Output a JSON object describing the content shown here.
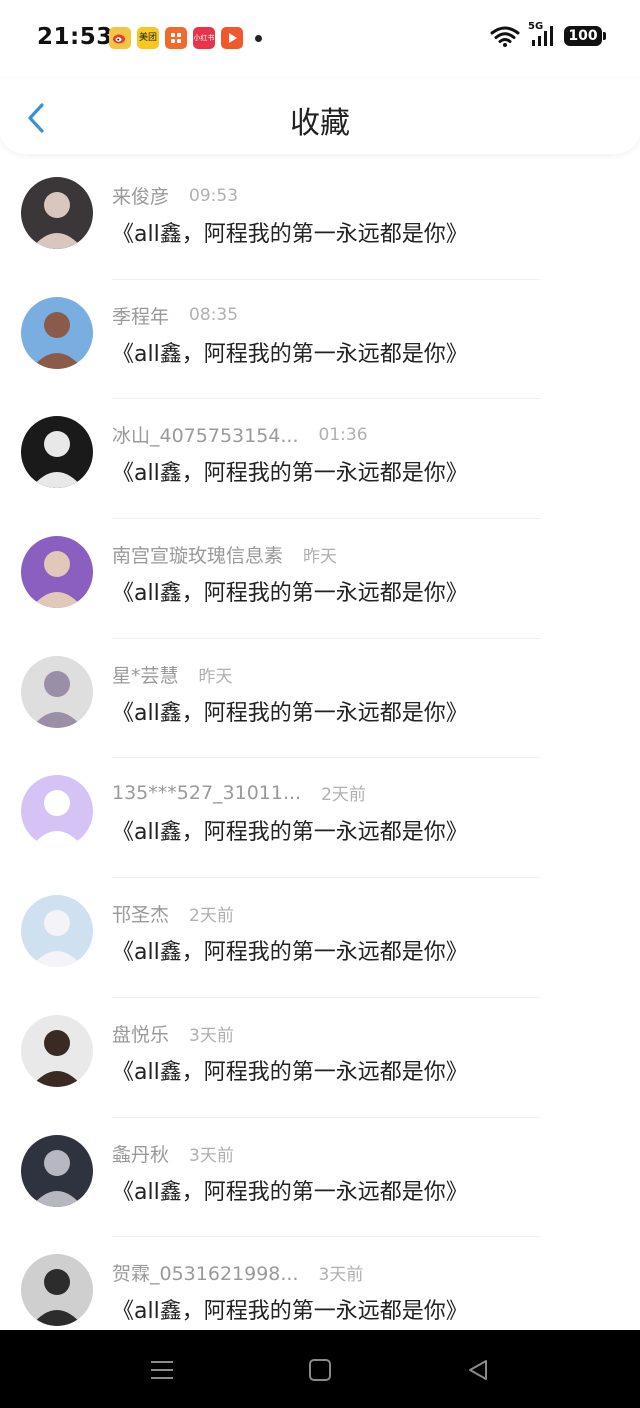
{
  "status_bar": {
    "time": "21:53",
    "network": "5G",
    "battery": "100",
    "apps": [
      {
        "icon": "weibo-icon",
        "label": "",
        "color": "#f4c542"
      },
      {
        "icon": "meituan-icon",
        "label": "美团",
        "color": "#f7c81f"
      },
      {
        "icon": "app-icon-orange",
        "label": "",
        "color": "#f06a2e"
      },
      {
        "icon": "xiaohongshu-icon",
        "label": "小红书",
        "color": "#e8344a"
      },
      {
        "icon": "video-app-icon",
        "label": "",
        "color": "#f0592e"
      }
    ]
  },
  "header": {
    "title": "收藏",
    "back_icon": "chevron-left-icon",
    "accent": "#3a8fd9"
  },
  "list": {
    "items": [
      {
        "user": "来俊彦",
        "time": "09:53",
        "title": "《all鑫，阿程我的第一永远都是你》",
        "avatar": {
          "bg": "#3b3637",
          "fg": "#d9c6bf"
        }
      },
      {
        "user": "季程年",
        "time": "08:35",
        "title": "《all鑫，阿程我的第一永远都是你》",
        "avatar": {
          "bg": "#7aaee0",
          "fg": "#8a5a4a"
        }
      },
      {
        "user": "冰山_4075753154...",
        "time": "01:36",
        "title": "《all鑫，阿程我的第一永远都是你》",
        "avatar": {
          "bg": "#1a1a1a",
          "fg": "#e8e8e8"
        }
      },
      {
        "user": "南宫宣璇玫瑰信息素",
        "time": "昨天",
        "title": "《all鑫，阿程我的第一永远都是你》",
        "avatar": {
          "bg": "#8a5fc0",
          "fg": "#e2c8b8"
        }
      },
      {
        "user": "星*芸慧",
        "time": "昨天",
        "title": "《all鑫，阿程我的第一永远都是你》",
        "avatar": {
          "bg": "#dedede",
          "fg": "#9b8fa8"
        }
      },
      {
        "user": "135***527_31011...",
        "time": "2天前",
        "title": "《all鑫，阿程我的第一永远都是你》",
        "avatar": {
          "bg": "#d6c3f5",
          "fg": "#ffffff"
        }
      },
      {
        "user": "邗圣杰",
        "time": "2天前",
        "title": "《all鑫，阿程我的第一永远都是你》",
        "avatar": {
          "bg": "#cfe0f0",
          "fg": "#f3f3f8"
        }
      },
      {
        "user": "盘悦乐",
        "time": "3天前",
        "title": "《all鑫，阿程我的第一永远都是你》",
        "avatar": {
          "bg": "#e9e9e9",
          "fg": "#3a2a24"
        }
      },
      {
        "user": "螽丹秋",
        "time": "3天前",
        "title": "《all鑫，阿程我的第一永远都是你》",
        "avatar": {
          "bg": "#2f3340",
          "fg": "#b7b7c0"
        }
      },
      {
        "user": "贺霖_0531621998...",
        "time": "3天前",
        "title": "《all鑫，阿程我的第一永远都是你》",
        "avatar": {
          "bg": "#cfcfcf",
          "fg": "#2c2c2c"
        }
      }
    ]
  },
  "nav": {
    "buttons": [
      {
        "icon": "menu-icon"
      },
      {
        "icon": "home-square-icon"
      },
      {
        "icon": "back-triangle-icon"
      }
    ]
  }
}
